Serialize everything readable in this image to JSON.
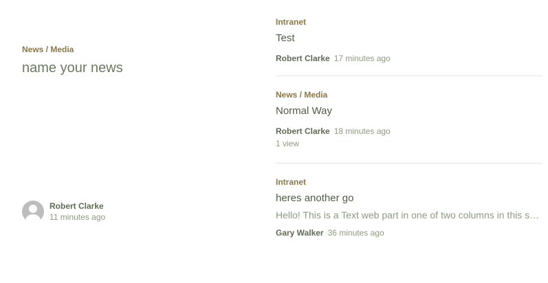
{
  "hero": {
    "category": "News / Media",
    "title": "name your news",
    "author": "Robert Clarke",
    "time": "11 minutes ago",
    "avatar_icon": "person-icon"
  },
  "news_items": [
    {
      "category": "Intranet",
      "title": "Test",
      "description": "",
      "author": "Robert Clarke",
      "time": "17 minutes ago",
      "views": ""
    },
    {
      "category": "News / Media",
      "title": "Normal Way",
      "description": "",
      "author": "Robert Clarke",
      "time": "18 minutes ago",
      "views": "1 view"
    },
    {
      "category": "Intranet",
      "title": "heres another go",
      "description": "Hello! This is a Text web part in one of two columns in this se...",
      "author": "Gary Walker",
      "time": "36 minutes ago",
      "views": ""
    }
  ]
}
